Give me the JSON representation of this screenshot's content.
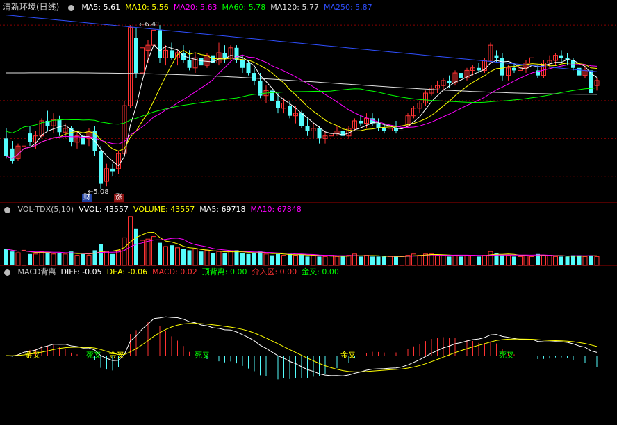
{
  "colors": {
    "up": "#ff3232",
    "down": "#54fcfc",
    "ma5": "#ffffff",
    "ma10": "#ffff00",
    "ma20": "#ff00ff",
    "ma60": "#00ff00",
    "ma120": "#e0e0e0",
    "ma250": "#2f4fff",
    "grid": "#8b0000",
    "diff": "#ffffff",
    "dea": "#ffff00"
  },
  "price_panel": {
    "title": "清新环境(日线)",
    "legend": [
      {
        "label": "MA5: 5.61",
        "color": "#ffffff"
      },
      {
        "label": "MA10: 5.56",
        "color": "#ffff00"
      },
      {
        "label": "MA20: 5.63",
        "color": "#ff00ff"
      },
      {
        "label": "MA60: 5.78",
        "color": "#00ff00"
      },
      {
        "label": "MA120: 5.77",
        "color": "#e0e0e0"
      },
      {
        "label": "MA250: 5.87",
        "color": "#2f4fff"
      }
    ],
    "high_label": "6.41",
    "low_label": "5.08",
    "tag_cai": "财",
    "tag_zhang": "涨"
  },
  "vol_panel": {
    "legend": [
      {
        "label": "VOL-TDX(5,10)",
        "color": "#c0c0c0"
      },
      {
        "label": "VVOL: 43557",
        "color": "#ffffff"
      },
      {
        "label": "VOLUME: 43557",
        "color": "#ffff00"
      },
      {
        "label": "MA5: 69718",
        "color": "#ffffff"
      },
      {
        "label": "MA10: 67848",
        "color": "#ff00ff"
      }
    ]
  },
  "macd_panel": {
    "legend": [
      {
        "label": "MACD背离",
        "color": "#c0c0c0"
      },
      {
        "label": "DIFF: -0.05",
        "color": "#ffffff"
      },
      {
        "label": "DEA: -0.06",
        "color": "#ffff00"
      },
      {
        "label": "MACD: 0.02",
        "color": "#ff3232"
      },
      {
        "label": "顶背离: 0.00",
        "color": "#00ff00"
      },
      {
        "label": "介入区: 0.00",
        "color": "#ff3232"
      },
      {
        "label": "金叉: 0.00",
        "color": "#00ff00"
      }
    ],
    "signals": [
      "金叉",
      "死叉",
      "金叉",
      "死叉",
      "金叉",
      "金叉",
      "死叉"
    ]
  },
  "chart_data": {
    "type": "candlestick",
    "ohlc": [
      [
        5.5,
        5.58,
        5.34,
        5.36
      ],
      [
        5.42,
        5.48,
        5.3,
        5.32
      ],
      [
        5.34,
        5.46,
        5.32,
        5.44
      ],
      [
        5.44,
        5.6,
        5.4,
        5.56
      ],
      [
        5.54,
        5.6,
        5.44,
        5.47
      ],
      [
        5.47,
        5.56,
        5.42,
        5.52
      ],
      [
        5.52,
        5.66,
        5.5,
        5.64
      ],
      [
        5.64,
        5.72,
        5.56,
        5.6
      ],
      [
        5.6,
        5.7,
        5.54,
        5.65
      ],
      [
        5.65,
        5.68,
        5.52,
        5.55
      ],
      [
        5.55,
        5.62,
        5.5,
        5.58
      ],
      [
        5.58,
        5.6,
        5.44,
        5.47
      ],
      [
        5.47,
        5.56,
        5.42,
        5.52
      ],
      [
        5.52,
        5.56,
        5.4,
        5.45
      ],
      [
        5.5,
        5.58,
        5.44,
        5.56
      ],
      [
        5.56,
        5.6,
        5.36,
        5.4
      ],
      [
        5.4,
        5.44,
        5.1,
        5.14
      ],
      [
        5.16,
        5.3,
        5.12,
        5.26
      ],
      [
        5.26,
        5.3,
        5.2,
        5.24
      ],
      [
        5.26,
        5.4,
        5.22,
        5.38
      ],
      [
        5.38,
        5.8,
        5.36,
        5.76
      ],
      [
        5.76,
        6.4,
        5.74,
        6.38
      ],
      [
        6.3,
        6.38,
        5.98,
        6.02
      ],
      [
        6.02,
        6.3,
        6.0,
        6.22
      ],
      [
        6.2,
        6.28,
        6.1,
        6.24
      ],
      [
        6.24,
        6.41,
        6.22,
        6.36
      ],
      [
        6.36,
        6.4,
        6.1,
        6.14
      ],
      [
        6.14,
        6.24,
        6.08,
        6.2
      ],
      [
        6.2,
        6.26,
        6.12,
        6.14
      ],
      [
        6.14,
        6.2,
        6.08,
        6.18
      ],
      [
        6.18,
        6.24,
        6.1,
        6.12
      ],
      [
        6.12,
        6.2,
        6.04,
        6.06
      ],
      [
        6.06,
        6.18,
        6.02,
        6.14
      ],
      [
        6.14,
        6.18,
        6.06,
        6.08
      ],
      [
        6.08,
        6.18,
        6.06,
        6.16
      ],
      [
        6.16,
        6.2,
        6.08,
        6.1
      ],
      [
        6.1,
        6.26,
        6.08,
        6.18
      ],
      [
        6.18,
        6.24,
        6.1,
        6.14
      ],
      [
        6.14,
        6.24,
        6.12,
        6.22
      ],
      [
        6.22,
        6.24,
        6.1,
        6.12
      ],
      [
        6.12,
        6.16,
        6.02,
        6.06
      ],
      [
        6.1,
        6.12,
        6.0,
        6.02
      ],
      [
        6.02,
        6.06,
        5.92,
        5.96
      ],
      [
        5.96,
        6.02,
        5.82,
        5.84
      ],
      [
        5.84,
        5.92,
        5.78,
        5.88
      ],
      [
        5.88,
        5.92,
        5.78,
        5.8
      ],
      [
        5.8,
        5.86,
        5.7,
        5.74
      ],
      [
        5.74,
        5.82,
        5.7,
        5.78
      ],
      [
        5.76,
        5.8,
        5.66,
        5.68
      ],
      [
        5.68,
        5.76,
        5.62,
        5.7
      ],
      [
        5.7,
        5.72,
        5.58,
        5.6
      ],
      [
        5.6,
        5.66,
        5.52,
        5.56
      ],
      [
        5.56,
        5.62,
        5.5,
        5.58
      ],
      [
        5.58,
        5.6,
        5.46,
        5.5
      ],
      [
        5.5,
        5.56,
        5.46,
        5.52
      ],
      [
        5.52,
        5.58,
        5.48,
        5.54
      ],
      [
        5.54,
        5.6,
        5.52,
        5.56
      ],
      [
        5.56,
        5.58,
        5.5,
        5.52
      ],
      [
        5.52,
        5.6,
        5.5,
        5.58
      ],
      [
        5.58,
        5.66,
        5.56,
        5.64
      ],
      [
        5.64,
        5.68,
        5.6,
        5.62
      ],
      [
        5.62,
        5.7,
        5.58,
        5.66
      ],
      [
        5.66,
        5.7,
        5.6,
        5.62
      ],
      [
        5.62,
        5.66,
        5.56,
        5.58
      ],
      [
        5.58,
        5.62,
        5.54,
        5.56
      ],
      [
        5.56,
        5.6,
        5.54,
        5.58
      ],
      [
        5.58,
        5.64,
        5.54,
        5.56
      ],
      [
        5.56,
        5.62,
        5.54,
        5.6
      ],
      [
        5.6,
        5.7,
        5.58,
        5.68
      ],
      [
        5.68,
        5.76,
        5.66,
        5.74
      ],
      [
        5.74,
        5.8,
        5.7,
        5.78
      ],
      [
        5.78,
        5.88,
        5.76,
        5.86
      ],
      [
        5.86,
        5.92,
        5.84,
        5.9
      ],
      [
        5.9,
        5.96,
        5.86,
        5.92
      ],
      [
        5.92,
        5.98,
        5.88,
        5.96
      ],
      [
        5.96,
        6.0,
        5.9,
        5.94
      ],
      [
        5.94,
        6.04,
        5.92,
        6.02
      ],
      [
        6.02,
        6.06,
        5.96,
        5.98
      ],
      [
        5.98,
        6.06,
        5.96,
        6.04
      ],
      [
        6.04,
        6.08,
        6.0,
        6.06
      ],
      [
        6.06,
        6.1,
        6.02,
        6.04
      ],
      [
        6.04,
        6.14,
        6.02,
        6.12
      ],
      [
        6.12,
        6.26,
        6.1,
        6.24
      ],
      [
        6.16,
        6.2,
        6.1,
        6.14
      ],
      [
        6.14,
        6.18,
        5.96,
        6.0
      ],
      [
        6.0,
        6.08,
        5.96,
        6.06
      ],
      [
        6.06,
        6.1,
        6.02,
        6.04
      ],
      [
        6.04,
        6.08,
        6.0,
        6.06
      ],
      [
        6.06,
        6.12,
        6.02,
        6.1
      ],
      [
        6.1,
        6.16,
        6.06,
        6.14
      ],
      [
        6.04,
        6.08,
        5.98,
        6.0
      ],
      [
        6.0,
        6.12,
        5.98,
        6.1
      ],
      [
        6.1,
        6.16,
        6.06,
        6.12
      ],
      [
        6.12,
        6.18,
        6.08,
        6.16
      ],
      [
        6.16,
        6.2,
        6.1,
        6.14
      ],
      [
        6.14,
        6.18,
        6.08,
        6.12
      ],
      [
        6.12,
        6.14,
        6.04,
        6.06
      ],
      [
        6.06,
        6.1,
        5.98,
        6.0
      ],
      [
        6.0,
        6.08,
        5.98,
        6.04
      ],
      [
        6.04,
        6.06,
        5.84,
        5.86
      ],
      [
        5.92,
        5.98,
        5.88,
        5.96
      ]
    ],
    "volume": [
      26,
      22,
      20,
      24,
      18,
      18,
      22,
      20,
      18,
      20,
      18,
      22,
      16,
      18,
      16,
      24,
      34,
      22,
      18,
      24,
      44,
      78,
      58,
      40,
      42,
      46,
      36,
      30,
      32,
      28,
      26,
      24,
      26,
      22,
      24,
      20,
      22,
      20,
      22,
      24,
      20,
      18,
      20,
      22,
      18,
      16,
      18,
      16,
      18,
      16,
      18,
      14,
      16,
      14,
      14,
      16,
      14,
      14,
      16,
      18,
      14,
      16,
      14,
      14,
      14,
      14,
      14,
      14,
      16,
      18,
      16,
      18,
      18,
      16,
      16,
      14,
      16,
      14,
      16,
      16,
      14,
      16,
      22,
      20,
      16,
      16,
      14,
      14,
      16,
      14,
      18,
      16,
      16,
      14,
      14,
      14,
      16,
      16,
      14,
      16,
      14
    ],
    "ylim": [
      5.0,
      6.5
    ]
  }
}
